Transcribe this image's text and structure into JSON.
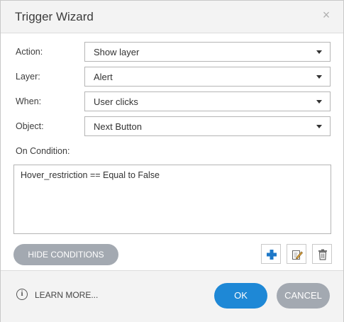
{
  "dialog": {
    "title": "Trigger Wizard",
    "close_glyph": "×"
  },
  "fields": {
    "action": {
      "label": "Action:",
      "value": "Show layer"
    },
    "layer": {
      "label": "Layer:",
      "value": "Alert"
    },
    "when": {
      "label": "When:",
      "value": "User clicks"
    },
    "object": {
      "label": "Object:",
      "value": "Next Button"
    }
  },
  "conditions": {
    "label": "On Condition:",
    "items": [
      "Hover_restriction == Equal to False"
    ],
    "hide_label": "HIDE CONDITIONS",
    "icons": [
      "add-icon",
      "edit-icon",
      "delete-icon"
    ]
  },
  "footer": {
    "info_glyph": "i",
    "learn_more": "LEARN MORE...",
    "ok": "OK",
    "cancel": "CANCEL"
  },
  "colors": {
    "primary": "#1e88d6",
    "secondary": "#a3a9b1",
    "add_icon": "#1e78c8"
  }
}
